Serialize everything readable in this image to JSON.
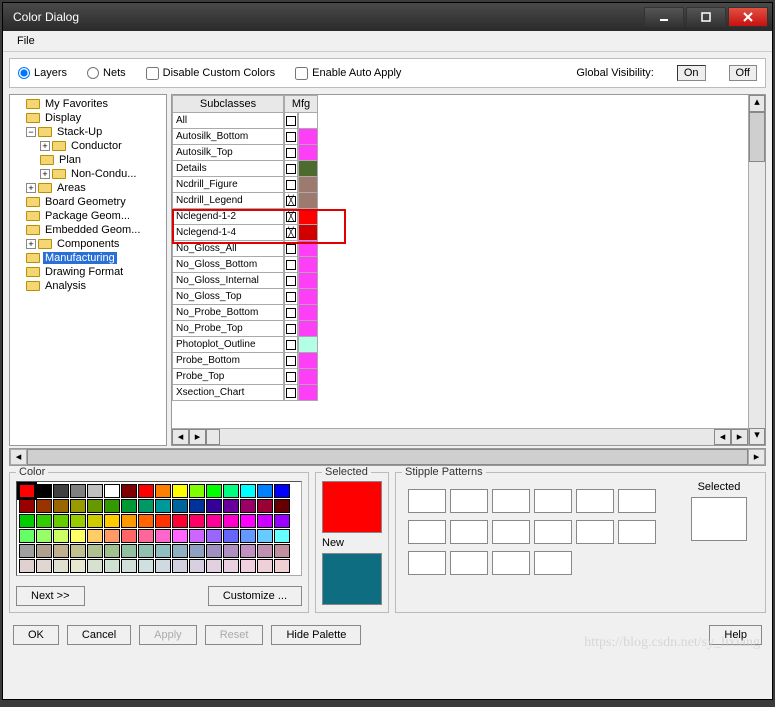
{
  "window": {
    "title": "Color Dialog"
  },
  "menu": {
    "file": "File"
  },
  "top": {
    "layers": "Layers",
    "nets": "Nets",
    "disable_custom": "Disable Custom Colors",
    "enable_auto": "Enable Auto Apply",
    "global_vis": "Global Visibility:",
    "on": "On",
    "off": "Off"
  },
  "tree": {
    "items": [
      "My Favorites",
      "Display",
      "Stack-Up",
      "Conductor",
      "Plan",
      "Non-Condu...",
      "Areas",
      "Board Geometry",
      "Package Geom...",
      "Embedded Geom...",
      "Components",
      "Manufacturing",
      "Drawing Format",
      "Analysis"
    ]
  },
  "grid": {
    "h1": "Subclasses",
    "h2": "Mfg",
    "rows": [
      {
        "name": "All",
        "chk": false,
        "color": ""
      },
      {
        "name": "Autosilk_Bottom",
        "chk": false,
        "color": "#ff3ef8"
      },
      {
        "name": "Autosilk_Top",
        "chk": false,
        "color": "#ff3ef8"
      },
      {
        "name": "Details",
        "chk": false,
        "color": "#4d6b2f"
      },
      {
        "name": "Ncdrill_Figure",
        "chk": false,
        "color": "#9c7a6d"
      },
      {
        "name": "Ncdrill_Legend",
        "chk": true,
        "color": "#9c7a6d"
      },
      {
        "name": "Nclegend-1-2",
        "chk": true,
        "color": "#ff0000"
      },
      {
        "name": "Nclegend-1-4",
        "chk": true,
        "color": "#d10000"
      },
      {
        "name": "No_Gloss_All",
        "chk": false,
        "color": "#ff3ef8"
      },
      {
        "name": "No_Gloss_Bottom",
        "chk": false,
        "color": "#ff3ef8"
      },
      {
        "name": "No_Gloss_Internal",
        "chk": false,
        "color": "#ff3ef8"
      },
      {
        "name": "No_Gloss_Top",
        "chk": false,
        "color": "#ff3ef8"
      },
      {
        "name": "No_Probe_Bottom",
        "chk": false,
        "color": "#ff3ef8"
      },
      {
        "name": "No_Probe_Top",
        "chk": false,
        "color": "#ff3ef8"
      },
      {
        "name": "Photoplot_Outline",
        "chk": false,
        "color": "#b3ffe6"
      },
      {
        "name": "Probe_Bottom",
        "chk": false,
        "color": "#ff3ef8"
      },
      {
        "name": "Probe_Top",
        "chk": false,
        "color": "#ff3ef8"
      },
      {
        "name": "Xsection_Chart",
        "chk": false,
        "color": "#ff3ef8"
      }
    ]
  },
  "panels": {
    "color": "Color",
    "selected": "Selected",
    "new": "New",
    "stipple": "Stipple Patterns",
    "selected2": "Selected",
    "next": "Next >>",
    "customize": "Customize ..."
  },
  "colors": {
    "selected": "#ff0000",
    "new": "#0f6d82",
    "palette": [
      "#ff0000",
      "#000000",
      "#404040",
      "#808080",
      "#c0c0c0",
      "#ffffff",
      "#800000",
      "#ff0000",
      "#ff8000",
      "#ffff00",
      "#80ff00",
      "#00ff00",
      "#00ff80",
      "#00ffff",
      "#0080ff",
      "#0000ff",
      "#990000",
      "#993300",
      "#996600",
      "#999900",
      "#669900",
      "#339900",
      "#009933",
      "#009966",
      "#009999",
      "#006699",
      "#003399",
      "#330099",
      "#660099",
      "#990066",
      "#990033",
      "#660000",
      "#00cc00",
      "#33cc00",
      "#66cc00",
      "#99cc00",
      "#cccc00",
      "#ffcc00",
      "#ff9900",
      "#ff6600",
      "#ff3300",
      "#ff0033",
      "#ff0066",
      "#ff0099",
      "#ff00cc",
      "#ff00ff",
      "#cc00ff",
      "#9900ff",
      "#66ff66",
      "#99ff66",
      "#ccff66",
      "#ffff66",
      "#ffcc66",
      "#ff9966",
      "#ff6666",
      "#ff6699",
      "#ff66cc",
      "#ff66ff",
      "#cc66ff",
      "#9966ff",
      "#6666ff",
      "#6699ff",
      "#66ccff",
      "#66ffff",
      "#a0a0a0",
      "#b0a090",
      "#c0b090",
      "#c0c090",
      "#b0c090",
      "#a0c090",
      "#90c0a0",
      "#90c0b0",
      "#90c0c0",
      "#90b0c0",
      "#90a0c0",
      "#a090c0",
      "#b090c0",
      "#c090c0",
      "#c090b0",
      "#c090a0",
      "#e0d0d0",
      "#e0d8d0",
      "#e0e0d0",
      "#e8e8d0",
      "#d8e0d0",
      "#d0e0d0",
      "#d0e0d8",
      "#d0e0e0",
      "#d0d8e0",
      "#d0d0e0",
      "#d8d0e0",
      "#e0d0e0",
      "#e8d0e0",
      "#f0d0e0",
      "#f0d0d8",
      "#f0d0d0"
    ]
  },
  "buttons": {
    "ok": "OK",
    "cancel": "Cancel",
    "apply": "Apply",
    "reset": "Reset",
    "hide": "Hide Palette",
    "help": "Help"
  },
  "watermark": "https://blog.csdn.net/sy_lixiang"
}
